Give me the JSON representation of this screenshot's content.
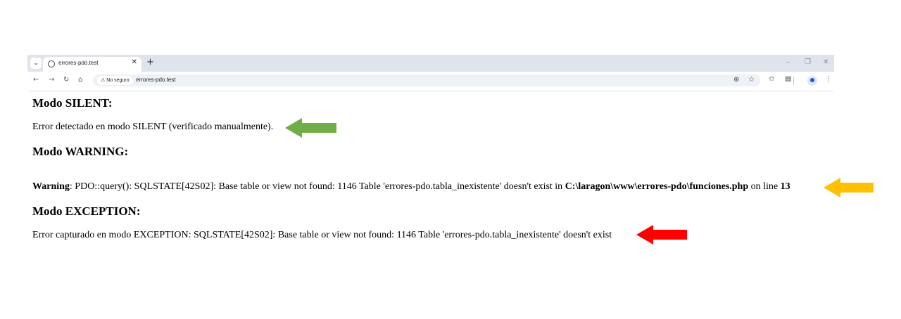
{
  "browser": {
    "tab_title": "errores-pdo.test",
    "secure_label": "No seguro",
    "url": "errores-pdo.test",
    "tab_list_icon": "chevron-down-icon",
    "new_tab_icon": "plus-icon"
  },
  "page": {
    "silent": {
      "heading": "Modo SILENT:",
      "message": "Error detectado en modo SILENT (verificado manualmente).",
      "arrow_color": "#70ad47"
    },
    "warning": {
      "heading": "Modo WARNING:",
      "label": "Warning",
      "message": ": PDO::query(): SQLSTATE[42S02]: Base table or view not found: 1146 Table 'errores-pdo.tabla_inexistente' doesn't exist in ",
      "file": "C:\\laragon\\www\\errores-pdo\\funciones.php",
      "on_line": " on line ",
      "line_number": "13",
      "arrow_color": "#ffc000"
    },
    "exception": {
      "heading": "Modo EXCEPTION:",
      "message": "Error capturado en modo EXCEPTION: SQLSTATE[42S02]: Base table or view not found: 1146 Table 'errores-pdo.tabla_inexistente' doesn't exist",
      "arrow_color": "#ff0000"
    }
  }
}
